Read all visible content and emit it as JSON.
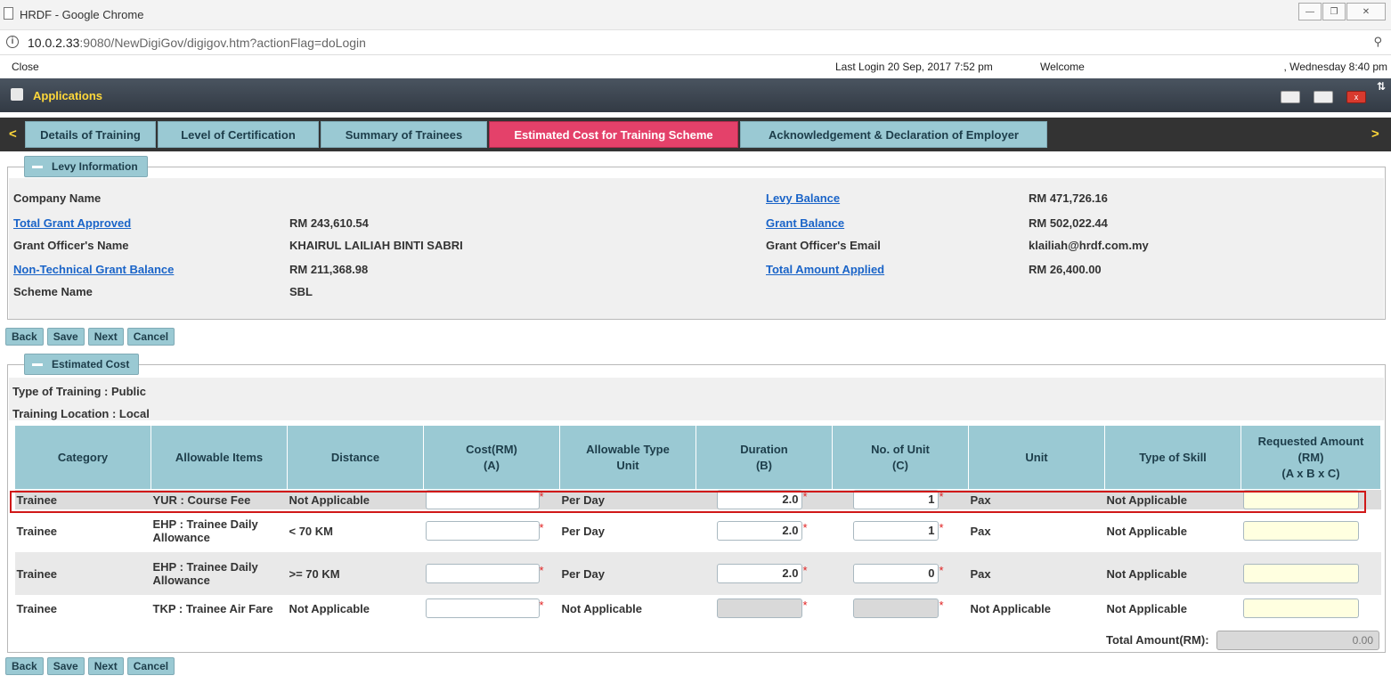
{
  "window": {
    "title": "HRDF - Google Chrome",
    "url_host": "10.0.2.33",
    "url_rest": ":9080/NewDigiGov/digigov.htm?actionFlag=doLogin"
  },
  "status": {
    "close_label": "Close",
    "last_login": "Last Login 20 Sep, 2017 7:52 pm",
    "welcome": "Welcome",
    "date": ", Wednesday 8:40 pm"
  },
  "app": {
    "title": "Applications"
  },
  "tabs": [
    {
      "label": "Details of Training"
    },
    {
      "label": "Level of Certification"
    },
    {
      "label": "Summary of Trainees"
    },
    {
      "label": "Estimated Cost for Training Scheme",
      "active": true
    },
    {
      "label": "Acknowledgement & Declaration of Employer"
    }
  ],
  "levy": {
    "legend": "Levy Information",
    "company_name_label": "Company Name",
    "company_name_value": "",
    "total_grant_label": "Total Grant Approved",
    "total_grant_value": "RM 243,610.54",
    "officer_name_label": "Grant Officer's Name",
    "officer_name_value": "KHAIRUL LAILIAH BINTI SABRI",
    "nontech_label": "Non-Technical Grant Balance",
    "nontech_value": "RM 211,368.98",
    "scheme_label": "Scheme Name",
    "scheme_value": "SBL",
    "levy_balance_label": "Levy Balance",
    "levy_balance_value": "RM 471,726.16",
    "grant_balance_label": "Grant Balance",
    "grant_balance_value": "RM 502,022.44",
    "officer_email_label": "Grant Officer's Email",
    "officer_email_value": "klailiah@hrdf.com.my",
    "total_applied_label": "Total Amount Applied",
    "total_applied_value": "RM 26,400.00"
  },
  "buttons": {
    "back": "Back",
    "save": "Save",
    "next": "Next",
    "cancel": "Cancel"
  },
  "cost": {
    "legend": "Estimated Cost",
    "type_of_training": "Type of Training : Public",
    "training_location": "Training Location : Local",
    "headers": {
      "category": "Category",
      "items": "Allowable Items",
      "distance": "Distance",
      "cost_l1": "Cost(RM)",
      "cost_l2": "(A)",
      "type_unit_l1": "Allowable Type",
      "type_unit_l2": "Unit",
      "duration_l1": "Duration",
      "duration_l2": "(B)",
      "no_unit_l1": "No. of Unit",
      "no_unit_l2": "(C)",
      "unit": "Unit",
      "skill": "Type of Skill",
      "req_l1": "Requested Amount",
      "req_l2": "(RM)",
      "req_l3": "(A x B x C)"
    },
    "rows": [
      {
        "category": "Trainee",
        "item": "YUR : Course Fee",
        "distance": "Not Applicable",
        "cost": "",
        "type_unit": "Per Day",
        "duration": "2.0",
        "no_unit": "1",
        "unit": "Pax",
        "skill": "Not Applicable",
        "requested": ""
      },
      {
        "category": "Trainee",
        "item": "EHP : Trainee Daily Allowance",
        "distance": "< 70 KM",
        "cost": "",
        "type_unit": "Per Day",
        "duration": "2.0",
        "no_unit": "1",
        "unit": "Pax",
        "skill": "Not Applicable",
        "requested": ""
      },
      {
        "category": "Trainee",
        "item": "EHP : Trainee Daily Allowance",
        "distance": ">= 70 KM",
        "cost": "",
        "type_unit": "Per Day",
        "duration": "2.0",
        "no_unit": "0",
        "unit": "Pax",
        "skill": "Not Applicable",
        "requested": ""
      },
      {
        "category": "Trainee",
        "item": "TKP : Trainee Air Fare",
        "distance": "Not Applicable",
        "cost": "",
        "type_unit": "Not Applicable",
        "duration": "",
        "no_unit": "",
        "unit": "Not Applicable",
        "skill": "Not Applicable",
        "requested": ""
      }
    ],
    "total_label": "Total Amount(RM):",
    "total_value": "0.00"
  }
}
